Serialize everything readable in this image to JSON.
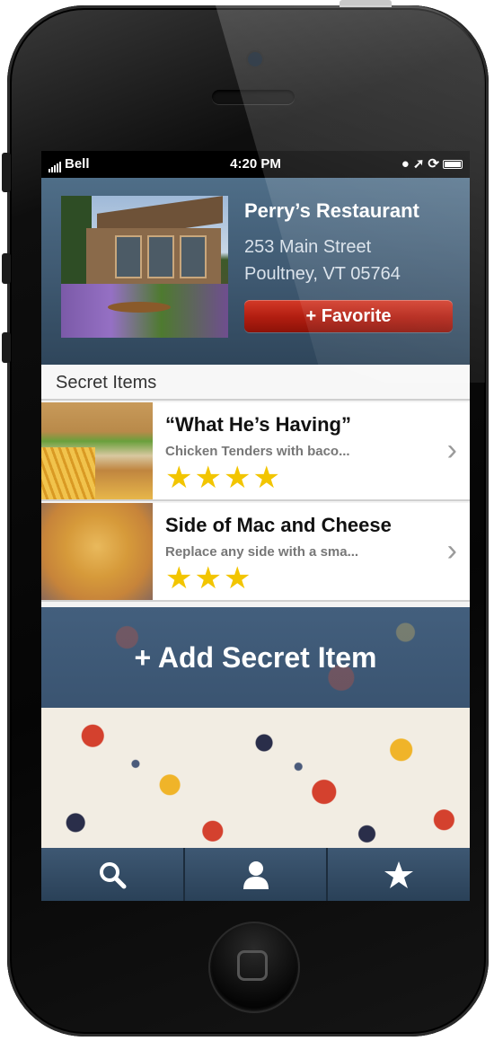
{
  "status_bar": {
    "carrier": "Bell",
    "time": "4:20 PM"
  },
  "restaurant": {
    "name": "Perry’s Restaurant",
    "address_line1": "253 Main Street",
    "address_line2": "Poultney, VT 05764",
    "favorite_label": "+ Favorite"
  },
  "section": {
    "title": "Secret Items"
  },
  "items": [
    {
      "title": "“What He’s Having”",
      "description": "Chicken Tenders with baco...",
      "rating": 4,
      "stars": "★★★★"
    },
    {
      "title": "Side of Mac and Cheese",
      "description": "Replace any side with a sma...",
      "rating": 3,
      "stars": "★★★"
    }
  ],
  "add_item": {
    "label": "+ Add Secret Item"
  },
  "tabbar": {
    "tabs": [
      {
        "icon": "search-icon"
      },
      {
        "icon": "person-icon"
      },
      {
        "icon": "star-icon"
      }
    ]
  },
  "colors": {
    "accent_red": "#c0281a",
    "header_blue": "#3e5870",
    "star_yellow": "#f2c500"
  }
}
